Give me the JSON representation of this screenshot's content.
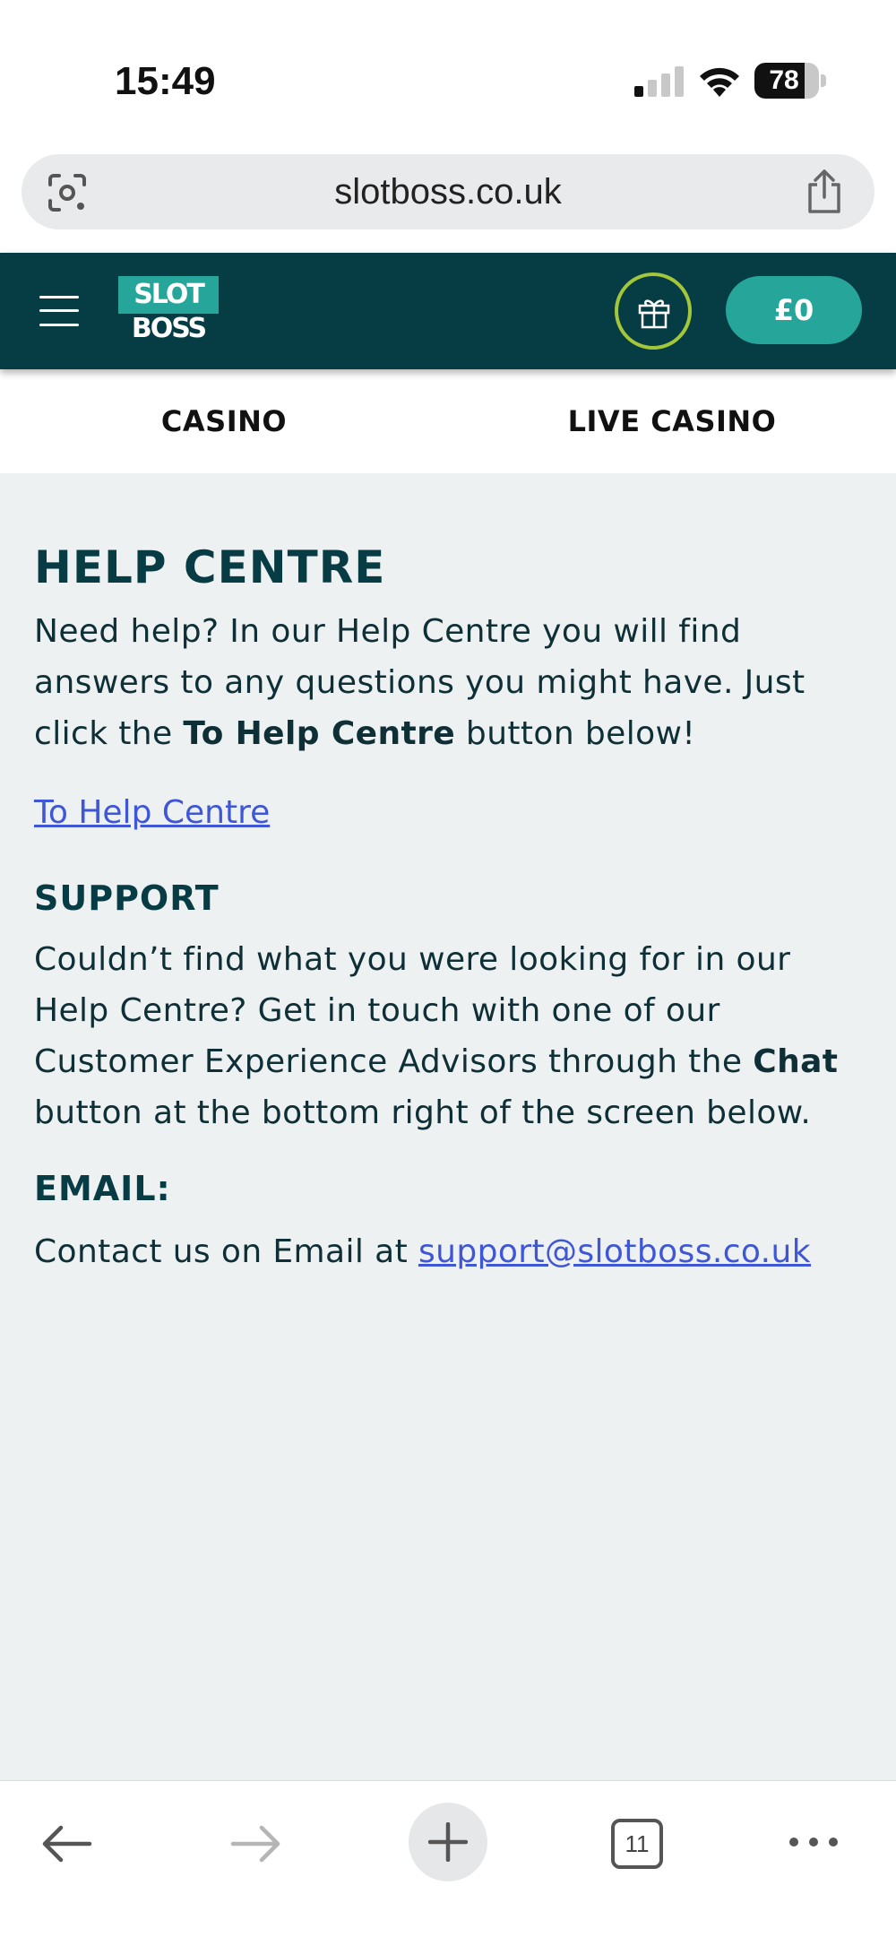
{
  "status_bar": {
    "time": "15:49",
    "battery_percent": 78,
    "battery_text": "78",
    "signal_bars_active": 1,
    "signal_bars_total": 4
  },
  "browser": {
    "url": "slotboss.co.uk",
    "icons": [
      "lens-icon",
      "share-icon"
    ],
    "open_tabs": "11"
  },
  "header": {
    "logo_top": "SLOT",
    "logo_bottom": "BOSS",
    "balance": "£0",
    "colors": {
      "header_bg": "#063d45",
      "accent": "#26a69a",
      "gift_ring": "#a4c639"
    }
  },
  "tabs": [
    {
      "label": "CASINO"
    },
    {
      "label": "LIVE CASINO"
    }
  ],
  "content": {
    "help_title": "HELP CENTRE",
    "help_text_1": "Need help? In our Help Centre you will find answers to any questions you might have. Just click the ",
    "help_text_bold": "To Help Centre",
    "help_text_2": " button below!",
    "help_link": "To Help Centre",
    "support_title": "SUPPORT",
    "support_text_1": "Couldn’t find what you were looking for in our Help Centre? Get in touch with one of our Customer Experience Advisors through the ",
    "support_text_bold": "Chat",
    "support_text_2": " button at the bottom right of the screen below.",
    "email_title": "EMAIL:",
    "email_text": "Contact us on Email at ",
    "email_link": "support@slotboss.co.uk",
    "colors": {
      "heading": "#083c44",
      "link": "#3f57d6",
      "background": "#eef1f2"
    }
  }
}
